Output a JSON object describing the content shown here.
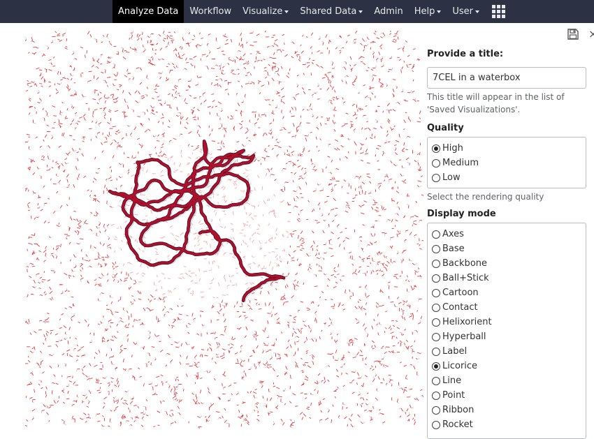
{
  "navbar": {
    "items": [
      {
        "label": "Analyze Data",
        "active": true,
        "dropdown": false
      },
      {
        "label": "Workflow",
        "active": false,
        "dropdown": false
      },
      {
        "label": "Visualize",
        "active": false,
        "dropdown": true
      },
      {
        "label": "Shared Data",
        "active": false,
        "dropdown": true
      },
      {
        "label": "Admin",
        "active": false,
        "dropdown": false
      },
      {
        "label": "Help",
        "active": false,
        "dropdown": true
      },
      {
        "label": "User",
        "active": false,
        "dropdown": true
      }
    ],
    "apps_icon": "grid-icon",
    "background": "#2c3143",
    "active_background": "#000000"
  },
  "toolbar": {
    "save_icon": "floppy-disk-icon",
    "close_icon": "close-icon",
    "close_glyph": "×"
  },
  "viewer": {
    "structure_id": "7CEL",
    "representation": "Licorice",
    "protein_color": "#b0102c",
    "water_color": "#e01818"
  },
  "form": {
    "title_label": "Provide a title:",
    "title_value": "7CEL in a waterbox",
    "title_help": "This title will appear in the list of 'Saved Visualizations'.",
    "quality_label": "Quality",
    "quality_options": [
      {
        "label": "High",
        "checked": true
      },
      {
        "label": "Medium",
        "checked": false
      },
      {
        "label": "Low",
        "checked": false
      }
    ],
    "quality_help": "Select the rendering quality",
    "display_label": "Display mode",
    "display_options": [
      {
        "label": "Axes",
        "checked": false
      },
      {
        "label": "Base",
        "checked": false
      },
      {
        "label": "Backbone",
        "checked": false
      },
      {
        "label": "Ball+Stick",
        "checked": false
      },
      {
        "label": "Cartoon",
        "checked": false
      },
      {
        "label": "Contact",
        "checked": false
      },
      {
        "label": "Helixorient",
        "checked": false
      },
      {
        "label": "Hyperball",
        "checked": false
      },
      {
        "label": "Label",
        "checked": false
      },
      {
        "label": "Licorice",
        "checked": true
      },
      {
        "label": "Line",
        "checked": false
      },
      {
        "label": "Point",
        "checked": false
      },
      {
        "label": "Ribbon",
        "checked": false
      },
      {
        "label": "Rocket",
        "checked": false
      }
    ]
  }
}
